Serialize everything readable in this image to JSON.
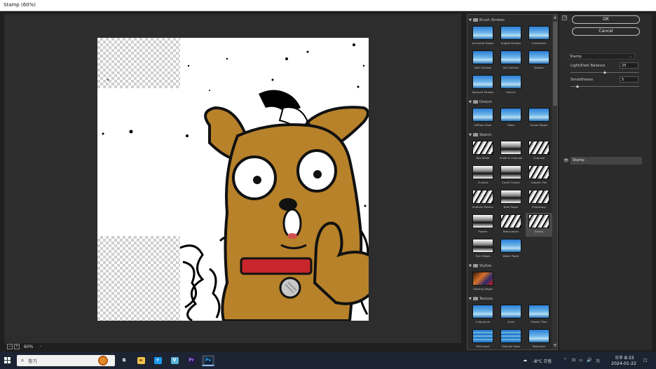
{
  "window": {
    "title": "Stamp (60%)"
  },
  "preview": {
    "zoom": "60%",
    "zoom_out_icon": "minus-square-icon",
    "zoom_in_icon": "plus-square-icon"
  },
  "gallery": {
    "categories": [
      {
        "name": "Brush Strokes",
        "items": [
          {
            "label": "Accented Edges",
            "style": "sky"
          },
          {
            "label": "Angled Strokes",
            "style": "sky"
          },
          {
            "label": "Crosshatch",
            "style": "sky"
          },
          {
            "label": "Dark Strokes",
            "style": "sky"
          },
          {
            "label": "Ink Outlines",
            "style": "sky"
          },
          {
            "label": "Spatter",
            "style": "sky"
          },
          {
            "label": "Sprayed Strokes",
            "style": "sky"
          },
          {
            "label": "Sumi-e",
            "style": "sky"
          }
        ]
      },
      {
        "name": "Distort",
        "items": [
          {
            "label": "Diffuse Glow",
            "style": "sky"
          },
          {
            "label": "Glass",
            "style": "sky"
          },
          {
            "label": "Ocean Ripple",
            "style": "sky"
          }
        ]
      },
      {
        "name": "Sketch",
        "items": [
          {
            "label": "Bas Relief",
            "style": "bw"
          },
          {
            "label": "Chalk & Charcoal",
            "style": "bw2"
          },
          {
            "label": "Charcoal",
            "style": "bw"
          },
          {
            "label": "Chrome",
            "style": "bw2"
          },
          {
            "label": "Conté Crayon",
            "style": "bw2"
          },
          {
            "label": "Graphic Pen",
            "style": "bw"
          },
          {
            "label": "Halftone Pattern",
            "style": "bw"
          },
          {
            "label": "Note Paper",
            "style": "bw2"
          },
          {
            "label": "Photocopy",
            "style": "bw"
          },
          {
            "label": "Plaster",
            "style": "bw2"
          },
          {
            "label": "Reticulation",
            "style": "bw"
          },
          {
            "label": "Stamp",
            "style": "bw",
            "selected": true
          },
          {
            "label": "Torn Edges",
            "style": "bw2"
          },
          {
            "label": "Water Paper",
            "style": "sky"
          }
        ]
      },
      {
        "name": "Stylize",
        "items": [
          {
            "label": "Glowing Edges",
            "style": "glow"
          }
        ]
      },
      {
        "name": "Texture",
        "items": [
          {
            "label": "Craquelure",
            "style": "sky"
          },
          {
            "label": "Grain",
            "style": "sky"
          },
          {
            "label": "Mosaic Tiles",
            "style": "sky"
          },
          {
            "label": "Patchwork",
            "style": "tex"
          },
          {
            "label": "Stained Glass",
            "style": "tex"
          },
          {
            "label": "Texturizer",
            "style": "sky"
          }
        ]
      }
    ]
  },
  "settings": {
    "ok_label": "OK",
    "cancel_label": "Cancel",
    "filter_select": "Stamp",
    "light_dark_label": "Light/Dark Balance",
    "light_dark_value": "25",
    "light_dark_max": 50,
    "smoothness_label": "Smoothness",
    "smoothness_value": "5",
    "smoothness_max": 50
  },
  "layers": {
    "items": [
      {
        "name": "Stamp",
        "visible": true
      }
    ]
  },
  "taskbar": {
    "search_placeholder": "찾기",
    "apps": [
      {
        "name": "task-view",
        "glyph": "⧉",
        "color": "#1c2433",
        "text": "#ffffff"
      },
      {
        "name": "file-explorer",
        "glyph": "▬",
        "color": "#f2c14e",
        "text": "#7a5a10"
      },
      {
        "name": "bird-app",
        "glyph": "✈",
        "color": "#1d9bf0",
        "text": "#ffffff"
      },
      {
        "name": "v-app",
        "glyph": "V",
        "color": "#5ab4d8",
        "text": "#ffffff"
      },
      {
        "name": "premiere",
        "glyph": "Pr",
        "color": "#2a1a4a",
        "text": "#9b8cff"
      },
      {
        "name": "photoshop",
        "glyph": "Ps",
        "color": "#0b1f33",
        "text": "#31a8ff",
        "active": true
      }
    ],
    "weather": "-8°C 흐림",
    "ime": "가",
    "time": "오후 8:33",
    "date": "2024-01-22"
  }
}
